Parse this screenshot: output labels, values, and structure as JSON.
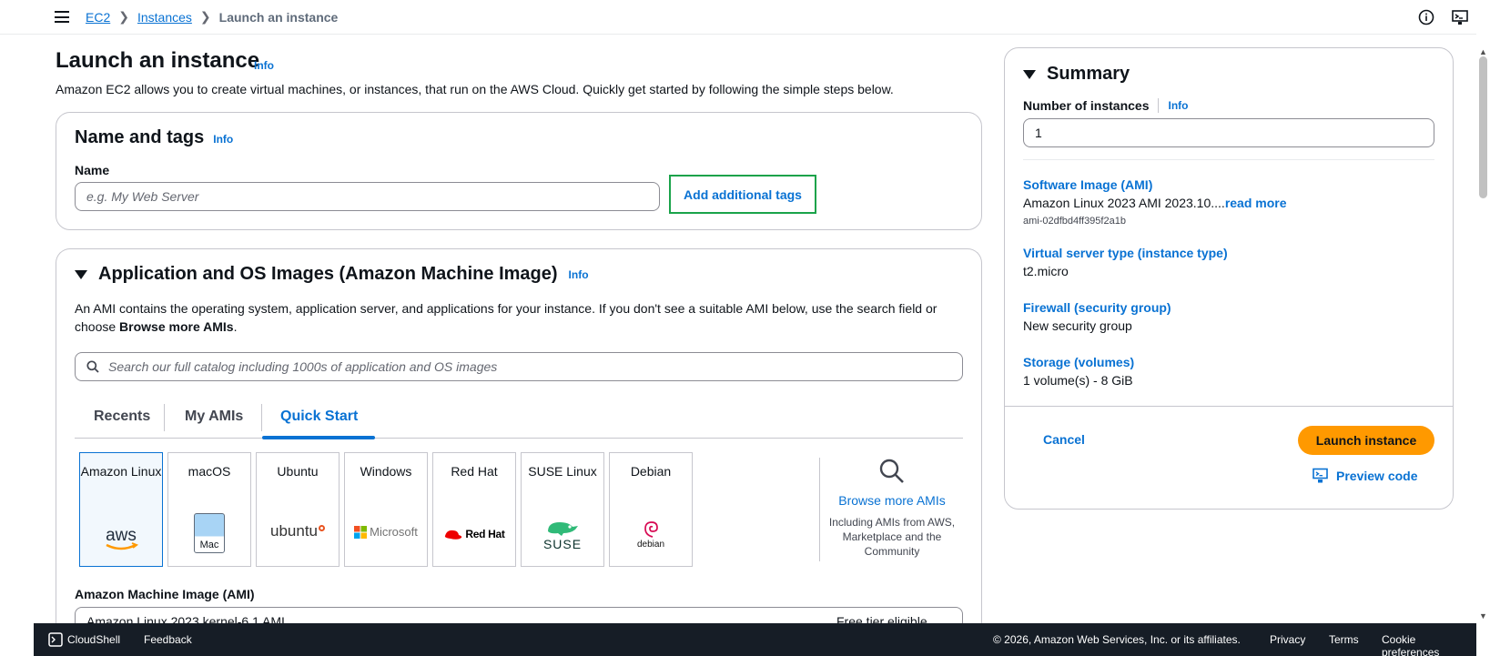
{
  "breadcrumb": {
    "root": "EC2",
    "section": "Instances",
    "current": "Launch an instance"
  },
  "page": {
    "title": "Launch an instance",
    "info": "Info",
    "description": "Amazon EC2 allows you to create virtual machines, or instances, that run on the AWS Cloud. Quickly get started by following the simple steps below."
  },
  "name_tags": {
    "title": "Name and tags",
    "info": "Info",
    "name_label": "Name",
    "name_placeholder": "e.g. My Web Server",
    "add_tags_label": "Add additional tags"
  },
  "ami": {
    "title": "Application and OS Images (Amazon Machine Image)",
    "info": "Info",
    "desc_part1": "An AMI contains the operating system, application server, and applications for your instance. If you don't see a suitable AMI below, use the search field or choose ",
    "desc_bold": "Browse more AMIs",
    "desc_end": ".",
    "search_placeholder": "Search our full catalog including 1000s of application and OS images",
    "tabs": [
      "Recents",
      "My AMIs",
      "Quick Start"
    ],
    "active_tab": "Quick Start",
    "os_options": [
      {
        "name": "Amazon Linux",
        "logo": "aws-logo"
      },
      {
        "name": "macOS",
        "logo": "mac-logo",
        "logo_text": "Mac"
      },
      {
        "name": "Ubuntu",
        "logo": "ubuntu-logo",
        "logo_text": "ubuntu"
      },
      {
        "name": "Windows",
        "logo": "microsoft-logo",
        "logo_text": "Microsoft"
      },
      {
        "name": "Red Hat",
        "logo": "redhat-logo",
        "logo_text": "Red Hat"
      },
      {
        "name": "SUSE Linux",
        "logo": "suse-logo",
        "logo_text": "SUSE"
      },
      {
        "name": "Debian",
        "logo": "debian-logo",
        "logo_text": "debian"
      }
    ],
    "browse_more_link": "Browse more AMIs",
    "browse_more_sub": "Including AMIs from AWS, Marketplace and the Community",
    "ami_label": "Amazon Machine Image (AMI)",
    "ami_selected": "Amazon Linux 2023 kernel-6.1 AMI",
    "ami_badge": "Free tier eligible"
  },
  "summary": {
    "title": "Summary",
    "num_instances_label": "Number of instances",
    "info": "Info",
    "num_instances_value": "1",
    "software_image_label": "Software Image (AMI)",
    "software_image_value": "Amazon Linux 2023 AMI 2023.10....",
    "read_more": "read more",
    "ami_id": "ami-02dfbd4ff395f2a1b",
    "instance_type_label": "Virtual server type (instance type)",
    "instance_type_value": "t2.micro",
    "firewall_label": "Firewall (security group)",
    "firewall_value": "New security group",
    "storage_label": "Storage (volumes)",
    "storage_value": "1 volume(s) - 8 GiB",
    "cancel": "Cancel",
    "launch": "Launch instance",
    "preview": "Preview code"
  },
  "footer": {
    "cloudshell": "CloudShell",
    "feedback": "Feedback",
    "copyright": "© 2026, Amazon Web Services, Inc. or its affiliates.",
    "privacy": "Privacy",
    "terms": "Terms",
    "cookies": "Cookie preferences"
  },
  "colors": {
    "link": "#0972d3",
    "launch": "#ff9900",
    "footer_bg": "#161d26",
    "highlight": "#1aa34a"
  }
}
